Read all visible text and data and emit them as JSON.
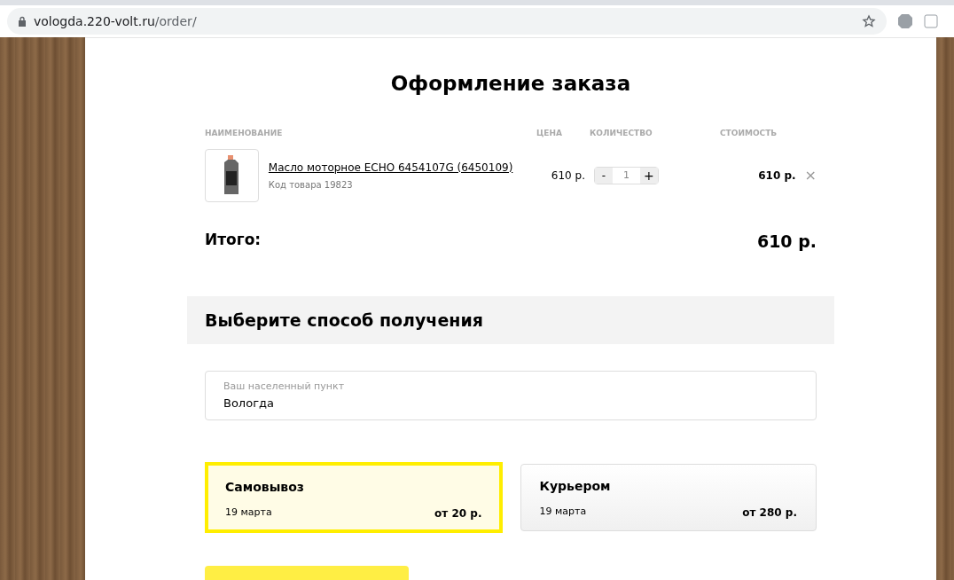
{
  "browser": {
    "url_host": "vologda.220-volt.ru",
    "url_path": "/order/"
  },
  "title": "Оформление заказа",
  "table": {
    "columns": [
      "НАИМЕНОВАНИЕ",
      "ЦЕНА",
      "КОЛИЧЕСТВО",
      "СТОИМОСТЬ"
    ],
    "rows": [
      {
        "name": "Масло моторное ECHO 6454107G (6450109)",
        "code": "Код товара 19823",
        "price": "610 р.",
        "minus": "-",
        "quantity": "1",
        "plus": "+",
        "cost": "610 р.",
        "remove": "×"
      }
    ]
  },
  "total": {
    "label": "Итого:",
    "value": "610 р."
  },
  "delivery": {
    "heading": "Выберите способ получения",
    "city": {
      "placeholder": "Ваш населенный пункт",
      "value": "Вологда"
    },
    "options": [
      {
        "name": "Самовывоз",
        "date": "19 марта",
        "price": "от 20 р.",
        "selected": true
      },
      {
        "name": "Курьером",
        "date": "19 марта",
        "price": "от 280 р.",
        "selected": false
      }
    ]
  }
}
